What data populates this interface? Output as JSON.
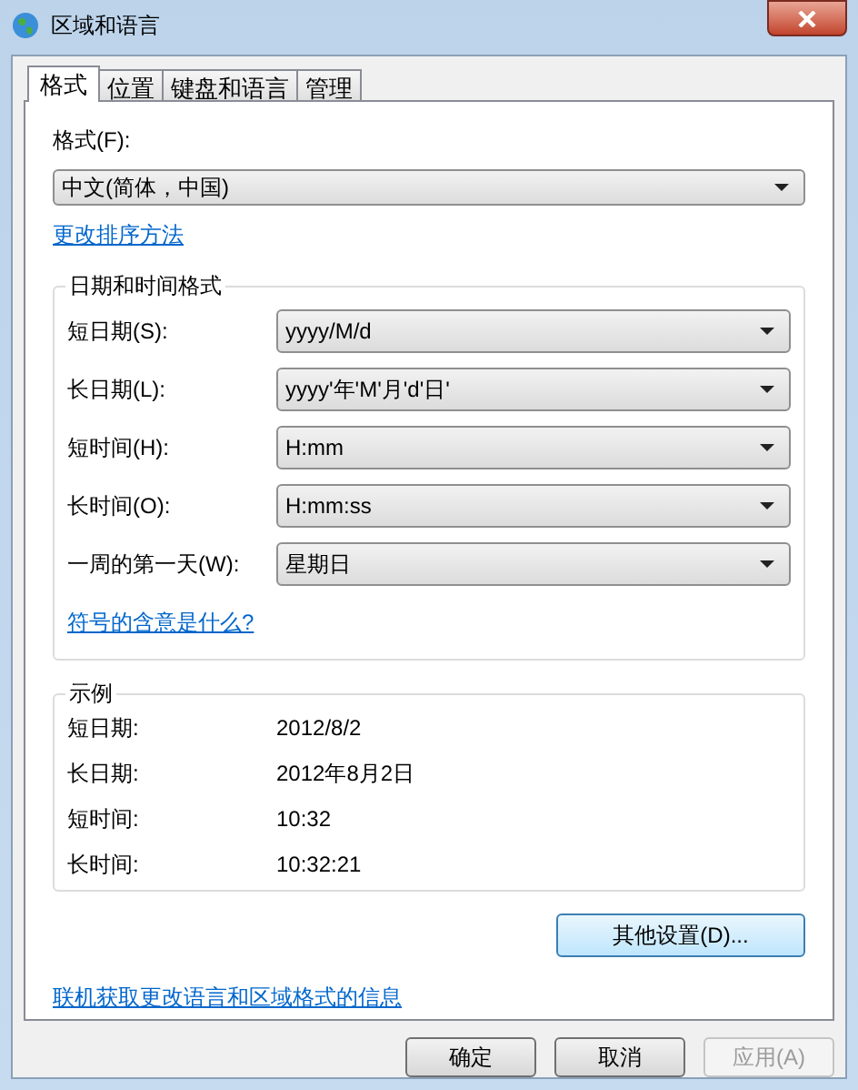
{
  "window": {
    "title": "区域和语言"
  },
  "tabs": [
    {
      "label": "格式",
      "selected": true
    },
    {
      "label": "位置",
      "selected": false
    },
    {
      "label": "键盘和语言",
      "selected": false
    },
    {
      "label": "管理",
      "selected": false
    }
  ],
  "format": {
    "label": "格式(F):",
    "value": "中文(简体，中国)"
  },
  "sort_link": "更改排序方法",
  "date_time_formats": {
    "title": "日期和时间格式",
    "rows": [
      {
        "label": "短日期(S):",
        "value": "yyyy/M/d"
      },
      {
        "label": "长日期(L):",
        "value": "yyyy'年'M'月'd'日'"
      },
      {
        "label": "短时间(H):",
        "value": "H:mm"
      },
      {
        "label": "长时间(O):",
        "value": "H:mm:ss"
      },
      {
        "label": "一周的第一天(W):",
        "value": "星期日"
      }
    ],
    "link": "符号的含意是什么?"
  },
  "examples": {
    "title": "示例",
    "rows": [
      {
        "label": "短日期:",
        "value": "2012/8/2"
      },
      {
        "label": "长日期:",
        "value": "2012年8月2日"
      },
      {
        "label": "短时间:",
        "value": "10:32"
      },
      {
        "label": "长时间:",
        "value": "10:32:21"
      }
    ]
  },
  "additional_settings_button": "其他设置(D)...",
  "online_link": "联机获取更改语言和区域格式的信息",
  "buttons": [
    {
      "label": "确定",
      "disabled": false
    },
    {
      "label": "取消",
      "disabled": false
    },
    {
      "label": "应用(A)",
      "disabled": true
    }
  ]
}
